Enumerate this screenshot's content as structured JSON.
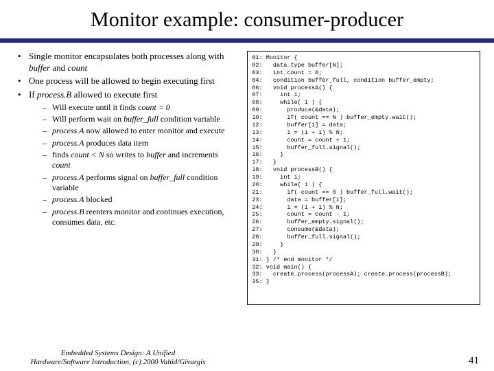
{
  "title": "Monitor example: consumer-producer",
  "bullets": {
    "b1a": "Single monitor encapsulates both processes along with ",
    "b1b": "buffer",
    "b1c": " and ",
    "b1d": "count",
    "b2": "One process will be allowed to begin executing first",
    "b3a": "If ",
    "b3b": "process.B",
    "b3c": " allowed to execute first",
    "s1a": "Will execute until it finds ",
    "s1b": "count = 0",
    "s2a": "Will perform wait on ",
    "s2b": "buffer_full",
    "s2c": " condition variable",
    "s3a": "process.A",
    "s3b": " now allowed to enter monitor and execute",
    "s4a": "process.A",
    "s4b": " produces data item",
    "s5a": "finds ",
    "s5b": "count < N",
    "s5c": " so writes to ",
    "s5d": "buffer",
    "s5e": " and increments ",
    "s5f": "count",
    "s6a": "process.A",
    "s6b": " performs signal on ",
    "s6c": "buffer_full",
    "s6d": " condition variable",
    "s7a": "process.A",
    "s7b": " blocked",
    "s8a": "process.B",
    "s8b": " reenters monitor and continues execution, consumes data, etc."
  },
  "code": "01: Monitor {\n02:   data_type buffer[N];\n03:   int count = 0;\n04:   condition buffer_full, condition buffer_empty;\n06:   void processA() {\n07:     int i;\n08:     while( 1 ) {\n09:       produce(&data);\n10:       if( count == N ) buffer_empty.wait();\n12:       buffer[i] = data;\n13:       i = (i + 1) % N;\n14:       count = count + 1;\n15:       buffer_full.signal();\n16:     }\n17:   }\n18:   void processB() {\n19:     int i;\n20:     while( 1 ) {\n21:       if( count == 0 ) buffer_full.wait();\n23:       data = buffer[i];\n24:       i = (i + 1) % N;\n25:       count = count - 1;\n26:       buffer_empty.signal();\n27:       consume(&data);\n28:       buffer_full.signal();\n29:     }\n30:   }\n31: } /* end monitor */\n32: void main() {\n33:   create_process(processA); create_process(processB);\n35: }",
  "footer": {
    "line1": "Embedded Systems Design: A Unified",
    "line2": "Hardware/Software Introduction, (c) 2000 Vahid/Givargis",
    "page": "41"
  }
}
